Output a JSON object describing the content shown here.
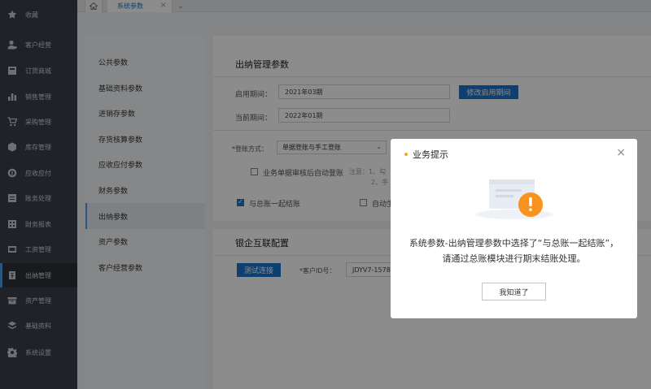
{
  "sidebar": {
    "items": [
      {
        "label": "收藏",
        "icon": "star-icon"
      },
      {
        "label": "客户经营",
        "icon": "user-icon"
      },
      {
        "label": "订货商城",
        "icon": "store-icon"
      },
      {
        "label": "销售管理",
        "icon": "bar-chart-icon"
      },
      {
        "label": "采购管理",
        "icon": "cart-icon"
      },
      {
        "label": "库存管理",
        "icon": "box-icon"
      },
      {
        "label": "应收应付",
        "icon": "coin-icon"
      },
      {
        "label": "账务处理",
        "icon": "ledger-icon"
      },
      {
        "label": "财务报表",
        "icon": "report-icon"
      },
      {
        "label": "工资管理",
        "icon": "wallet-icon"
      },
      {
        "label": "出纳管理",
        "icon": "cashier-icon"
      },
      {
        "label": "资产管理",
        "icon": "asset-icon"
      },
      {
        "label": "基础资料",
        "icon": "layers-icon"
      },
      {
        "label": "系统设置",
        "icon": "gear-icon"
      }
    ],
    "active_index": 10
  },
  "tabs": {
    "home_icon": "home-icon",
    "current": "系统参数",
    "close": "×",
    "menu": "⌄"
  },
  "params": {
    "items": [
      "公共参数",
      "基础资料参数",
      "进销存参数",
      "存货核算参数",
      "应收应付参数",
      "财务参数",
      "出纳参数",
      "资产参数",
      "客户经营参数"
    ],
    "active_index": 6
  },
  "cashier": {
    "title": "出纳管理参数",
    "start_period_label": "启用期间：",
    "start_period_value": "2021年03期",
    "modify_button": "修改启用期间",
    "current_period_label": "当前期间：",
    "current_period_value": "2022年01期",
    "posting_label": "*登账方式：",
    "posting_value": "单据登账与手工登账",
    "auto_post_label": "业务单据审核后自动登账",
    "note_line1": "注意：1、勾",
    "note_line2": "2、手",
    "with_ledger_label": "与总账一起结账",
    "auto_label": "自动生"
  },
  "bank": {
    "title": "银企互联配置",
    "test_button": "测试连接",
    "client_id_label": "*客户ID号：",
    "client_id_value": "JDYV7-1578"
  },
  "modal": {
    "title": "业务提示",
    "close": "×",
    "message": "系统参数-出纳管理参数中选择了“与总账一起结账”，请通过总账模块进行期末结账处理。",
    "confirm": "我知道了",
    "accent": "#f5a623"
  }
}
